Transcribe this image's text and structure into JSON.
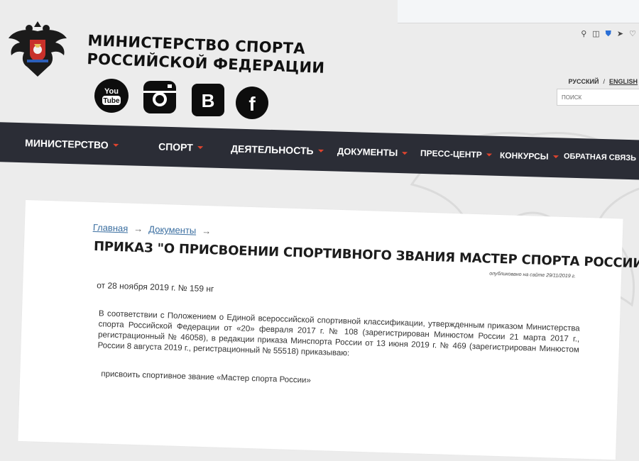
{
  "site": {
    "title_line1": "МИНИСТЕРСТВО СПОРТА",
    "title_line2": "РОССИЙСКОЙ ФЕДЕРАЦИИ"
  },
  "social": [
    {
      "icon": "youtube-icon",
      "text_top": "You",
      "text_bottom": "Tube"
    },
    {
      "icon": "instagram-icon"
    },
    {
      "icon": "vk-icon",
      "text": "B"
    },
    {
      "icon": "facebook-icon",
      "text": "f"
    }
  ],
  "language": {
    "ru": "РУССКИЙ",
    "separator": "/",
    "en": "ENGLISH"
  },
  "search": {
    "placeholder": "ПОИСК"
  },
  "nav": [
    {
      "label": "МИНИСТЕРСТВО"
    },
    {
      "label": "СПОРТ"
    },
    {
      "label": "ДЕЯТЕЛЬНОСТЬ"
    },
    {
      "label": "ДОКУМЕНТЫ"
    },
    {
      "label": "ПРЕСС-ЦЕНТР"
    },
    {
      "label": "КОНКУРСЫ"
    },
    {
      "label": "ОБРАТНАЯ СВЯЗЬ"
    }
  ],
  "breadcrumb": {
    "home": "Главная",
    "docs": "Документы",
    "arrow": "→"
  },
  "document": {
    "title": "ПРИКАЗ \"О ПРИСВОЕНИИ СПОРТИВНОГО ЗВАНИЯ МАСТЕР СПОРТА РОССИИ\"",
    "published": "опубликовано на сайте 29/11/2019 г.",
    "date_line": "от 28 ноября 2019 г. № 159 нг",
    "body": "В соответствии с Положением о Единой всероссийской спортивной классификации, утвержденным приказом Министерства спорта Российской Федерации от «20» февраля 2017 г. № 108 (зарегистрирован Минюстом России 21 марта 2017 г., регистрационный № 46058), в редакции приказа Минспорта России от 13 июня 2019 г. № 469 (зарегистрирован Минюстом России 8 августа 2019 г., регистрационный № 55518) приказываю:",
    "assign": "присвоить спортивное звание «Мастер спорта России»"
  },
  "colors": {
    "navbar": "#2b2d36",
    "accent": "#e0442e",
    "link": "#3a6ea0"
  }
}
